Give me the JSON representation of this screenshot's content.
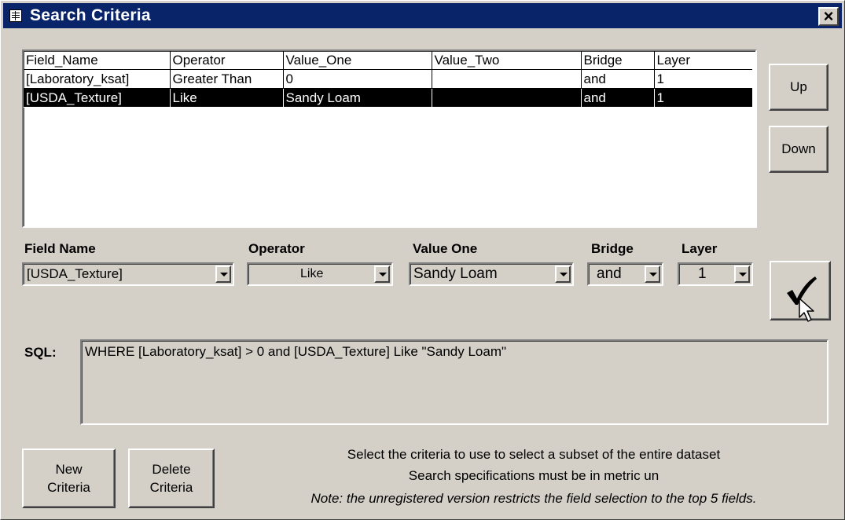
{
  "window": {
    "title": "Search Criteria"
  },
  "grid": {
    "columns": [
      "Field_Name",
      "Operator",
      "Value_One",
      "Value_Two",
      "Bridge",
      "Layer"
    ],
    "rows": [
      [
        "[Laboratory_ksat]",
        "Greater Than",
        "0",
        "",
        "and",
        "1"
      ],
      [
        "[USDA_Texture]",
        "Like",
        "Sandy Loam",
        "",
        "and",
        "1"
      ]
    ],
    "selected_row": 1
  },
  "buttons": {
    "up": "Up",
    "down": "Down",
    "new_line1": "New",
    "new_line2": "Criteria",
    "delete_line1": "Delete",
    "delete_line2": "Criteria"
  },
  "fields": {
    "field_name_label": "Field Name",
    "field_name_value": "[USDA_Texture]",
    "operator_label": "Operator",
    "operator_value": "Like",
    "value_one_label": "Value One",
    "value_one_value": "Sandy Loam",
    "bridge_label": "Bridge",
    "bridge_value": "and",
    "layer_label": "Layer",
    "layer_value": "1"
  },
  "sql": {
    "label": "SQL:",
    "text": "WHERE [Laboratory_ksat] > 0 and [USDA_Texture] Like \"Sandy Loam\""
  },
  "info": {
    "line1": "Select the criteria to use to select a subset of the entire dataset",
    "line2": "Search specifications must be in metric un",
    "note": "Note: the unregistered version restricts the field selection to the top 5 fields."
  },
  "icons": {
    "title": "form-icon",
    "close": "close-icon",
    "apply": "checkmark-icon",
    "cursor": "mouse-pointer-icon"
  },
  "colors": {
    "titlebar": "#0a246a",
    "face": "#d4d0c8",
    "selected_row": "#000000"
  }
}
